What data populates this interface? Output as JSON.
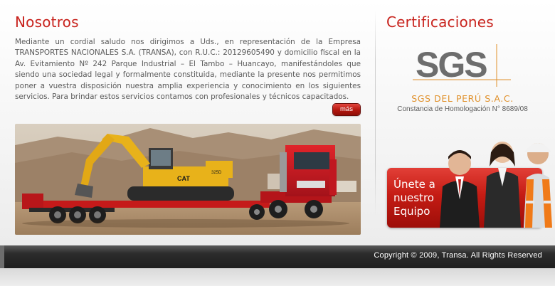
{
  "nosotros": {
    "title": "Nosotros",
    "intro": "Mediante un cordial saludo nos dirigimos a Uds., en representación de la Empresa TRANSPORTES NACIONALES S.A. (TRANSA), con R.U.C.: 20129605490 y domicilio fiscal en la Av. Evitamiento Nº 242 Parque Industrial – El Tambo – Huancayo, manifestándoles que siendo una sociedad legal y formalmente constituida, mediante la presente nos permitimos poner a vuestra disposición nuestra amplia experiencia y conocimiento en los siguientes servicios. Para brindar estos servicios contamos con profesionales y técnicos capacitados.",
    "more_label": "más",
    "photo": {
      "excavator_brand": "CAT",
      "excavator_model": "325D"
    }
  },
  "certificaciones": {
    "title": "Certificaciones",
    "logo_text": "SGS",
    "company": "SGS DEL PERÚ S.A.C.",
    "constancia": "Constancia de Homologación N° 8689/08"
  },
  "join": {
    "text_line1": "Únete a",
    "text_line2": "nuestro",
    "text_line3": "Equipo"
  },
  "footer": {
    "copyright": "Copyright © 2009, Transa. All Rights Reserved"
  },
  "colors": {
    "accent_red": "#c8231d",
    "sgs_orange": "#e0902a",
    "footer_dark": "#1e1e1e"
  }
}
